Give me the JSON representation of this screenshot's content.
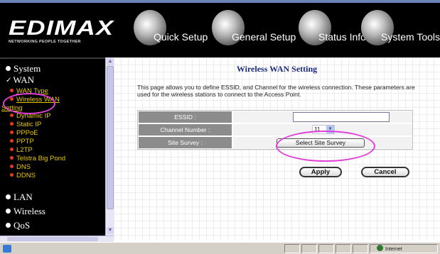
{
  "header": {
    "brand": "EDIMAX",
    "tagline": "NETWORKING PEOPLE TOGETHER",
    "tabs": [
      {
        "label": "Quick Setup",
        "icon": "quick-setup-globe-icon"
      },
      {
        "label": "General Setup",
        "icon": "general-setup-globe-icon"
      },
      {
        "label": "Status Info",
        "icon": "status-info-globe-icon"
      },
      {
        "label": "System Tools",
        "icon": "system-tools-globe-icon"
      }
    ]
  },
  "sidebar": {
    "sections": [
      "System",
      "WAN",
      "LAN",
      "Wireless",
      "QoS"
    ],
    "wan_items": [
      "WAN Type",
      "Wireless WAN",
      "Setting",
      "Dynamic IP",
      "Static IP",
      "PPPoE",
      "PPTP",
      "L2TP",
      "Telstra Big Pond",
      "DNS",
      "DDNS"
    ],
    "colors": {
      "item": "#e8c800",
      "bullet": "#e63b1a",
      "highlight": "#e040d8"
    }
  },
  "main": {
    "title": "Wireless WAN Setting",
    "description": "This page allows you to define ESSID, and Channel for the wireless connection. These parameters are used for the wireless stations to connect to the Access Point.",
    "fields": {
      "essid_label": "ESSID :",
      "essid_value": "",
      "channel_label": "Channel Number :",
      "channel_value": "11",
      "survey_label": "Site Survey :",
      "survey_button": "Select Site Survey"
    },
    "apply": "Apply",
    "cancel": "Cancel"
  },
  "statusbar": {
    "zone": "Internet"
  }
}
